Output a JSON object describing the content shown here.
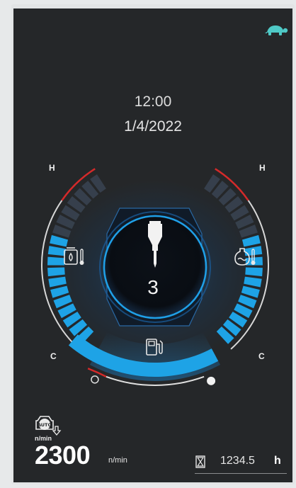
{
  "clock": {
    "time": "12:00",
    "date": "1/4/2022"
  },
  "mode": {
    "icon": "turtle-icon",
    "color": "#4fc9c6"
  },
  "coolant_gauge": {
    "high_label": "H",
    "low_label": "C",
    "segments_total": 18,
    "segments_lit": 11,
    "icon": "coolant-temperature-icon"
  },
  "hydraulic_gauge": {
    "high_label": "H",
    "low_label": "C",
    "segments_total": 18,
    "segments_lit": 11,
    "icon": "hydraulic-oil-temperature-icon"
  },
  "center": {
    "icon": "hydraulic-breaker-icon",
    "value": "3"
  },
  "fuel": {
    "icon": "fuel-pump-icon",
    "level_fraction": 0.85
  },
  "engine": {
    "icon": "auto-idle-icon",
    "icon_sublabel": "n/min",
    "rpm": "2300",
    "rpm_unit": "n/min"
  },
  "hour_meter": {
    "icon": "hourglass-icon",
    "value": "1234.5",
    "unit": "h"
  },
  "colors": {
    "accent_blue": "#1ea3e6",
    "warning_red": "#d42a2a",
    "background": "#252729"
  }
}
